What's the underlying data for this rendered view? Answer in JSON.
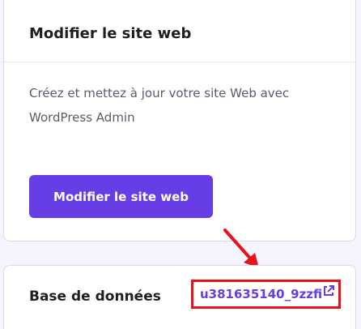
{
  "edit_card": {
    "title": "Modifier le site web",
    "description": "Créez et mettez à jour votre site Web avec WordPress Admin",
    "button_label": "Modifier le site web"
  },
  "database_card": {
    "label": "Base de données",
    "db_name": "u381635140_9zzfi",
    "link_icon": "external-link-icon"
  },
  "colors": {
    "accent": "#673de6",
    "highlight": "#e8121d",
    "background": "#f4f5ff"
  }
}
